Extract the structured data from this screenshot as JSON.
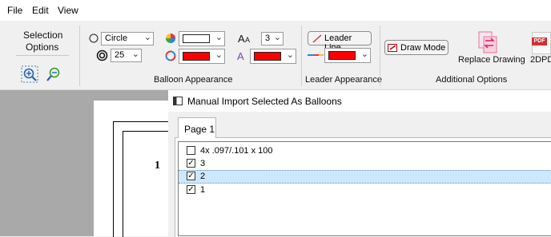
{
  "menu": {
    "file": "File",
    "edit": "Edit",
    "view": "View"
  },
  "ribbon": {
    "selection_options": {
      "label_line1": "Selection",
      "label_line2": "Options"
    },
    "balloon": {
      "shape": "Circle",
      "size": "25",
      "text_size": "3",
      "group_label": "Balloon Appearance"
    },
    "leader": {
      "leader_line_label": "Leader Line",
      "group_label": "Leader Appearance"
    },
    "additional": {
      "draw_mode_label": "Draw Mode",
      "replace_drawing_label": "Replace Drawing",
      "twod_label": "2DPD",
      "pdf_badge": "PDF",
      "group_label": "Additional Options"
    },
    "colors": {
      "fill": "#ffffff",
      "red": "#ff0000",
      "accent": "#c00000"
    }
  },
  "drawing": {
    "balloon_number": "1"
  },
  "dialog": {
    "title": "Manual Import Selected As Balloons",
    "tab_label": "Page 1",
    "items": [
      {
        "label": "4x .097/.101 x 100",
        "checked": false
      },
      {
        "label": "3",
        "checked": true
      },
      {
        "label": "2",
        "checked": true,
        "selected": true
      },
      {
        "label": "1",
        "checked": true
      }
    ]
  }
}
